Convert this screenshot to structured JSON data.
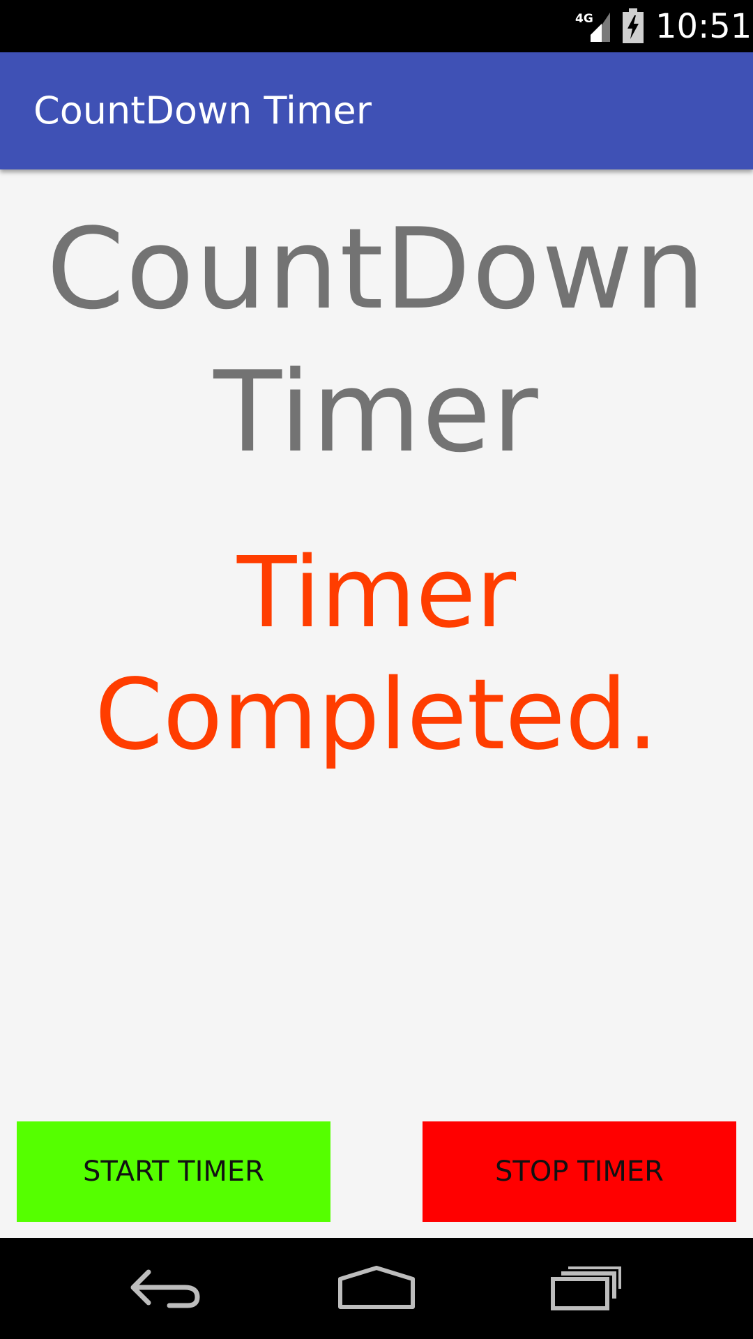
{
  "status_bar": {
    "network_label": "4G",
    "clock": "10:51",
    "icons": [
      "signal-icon",
      "battery-charging-icon"
    ]
  },
  "app_bar": {
    "title": "CountDown Timer",
    "color": "#3f51b5"
  },
  "main": {
    "heading": "CountDown Timer",
    "status_message": "Timer Completed.",
    "status_color": "#ff3d00"
  },
  "buttons": {
    "start_label": "START TIMER",
    "start_color": "#55ff00",
    "stop_label": "STOP TIMER",
    "stop_color": "#ff0000"
  },
  "nav_bar": {
    "icons": [
      "back-icon",
      "home-icon",
      "recents-icon"
    ]
  }
}
